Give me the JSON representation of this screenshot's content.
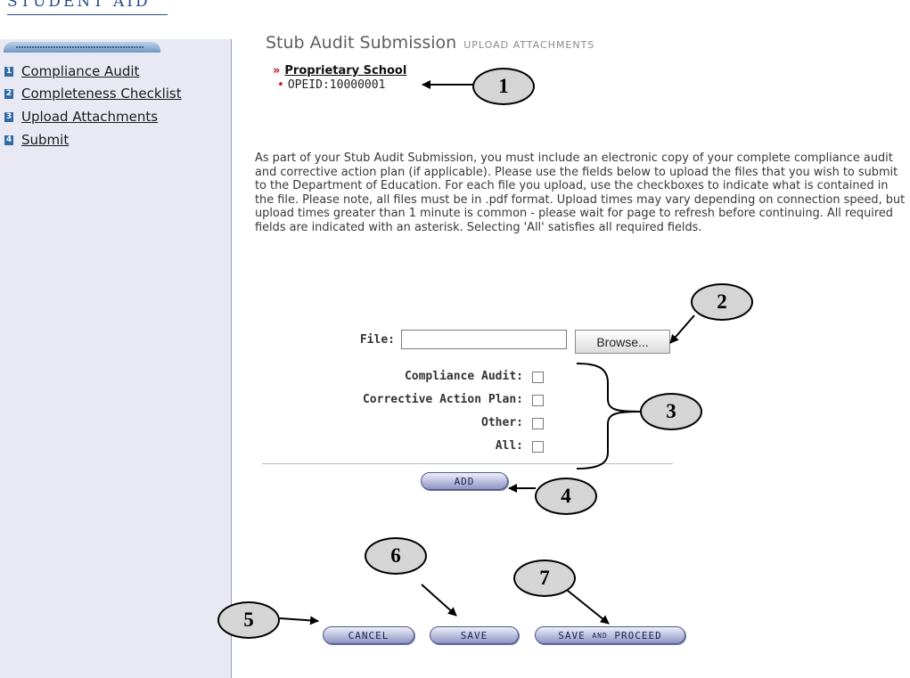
{
  "brand": {
    "text": "STUDENT AID"
  },
  "sidebar": {
    "items": [
      {
        "num": "1",
        "label": "Compliance Audit"
      },
      {
        "num": "2",
        "label": "Completeness Checklist"
      },
      {
        "num": "3",
        "label": "Upload Attachments"
      },
      {
        "num": "4",
        "label": "Submit"
      }
    ]
  },
  "header": {
    "title": "Stub Audit Submission",
    "subtitle": "UPLOAD ATTACHMENTS"
  },
  "school": {
    "chevron": "»",
    "name": "Proprietary School",
    "bullet": "•",
    "opeid": "OPEID:10000001"
  },
  "description": "As part of your Stub Audit Submission, you must include an electronic copy of your complete compliance audit and corrective action plan (if applicable). Please use the fields below to upload the files that you wish to submit to the Department of Education. For each file you upload, use the checkboxes to indicate what is contained in the file. Please note, all files must be in .pdf format. Upload times may vary depending on connection speed, but upload times greater than 1 minute is common - please wait for page to refresh before continuing. All required fields are indicated with an asterisk. Selecting 'All' satisfies all required fields.",
  "form": {
    "file_label": "File:",
    "file_value": "",
    "browse_label": "Browse...",
    "checkboxes": [
      {
        "label": "Compliance Audit:",
        "checked": false
      },
      {
        "label": "Corrective Action Plan:",
        "checked": false
      },
      {
        "label": "Other:",
        "checked": false
      },
      {
        "label": "All:",
        "checked": false
      }
    ],
    "add_label": "ADD"
  },
  "actions": {
    "cancel": "CANCEL",
    "save": "SAVE",
    "save_proceed_a": "SAVE ",
    "save_proceed_b": "AND",
    "save_proceed_c": " PROCEED"
  },
  "callouts": [
    "1",
    "2",
    "3",
    "4",
    "5",
    "6",
    "7"
  ],
  "colors": {
    "sidebar_bg": "#e9e9f3",
    "nav_number": "#2f6aa6",
    "accent_red": "#c8102e",
    "button_text": "#1b1f55"
  }
}
